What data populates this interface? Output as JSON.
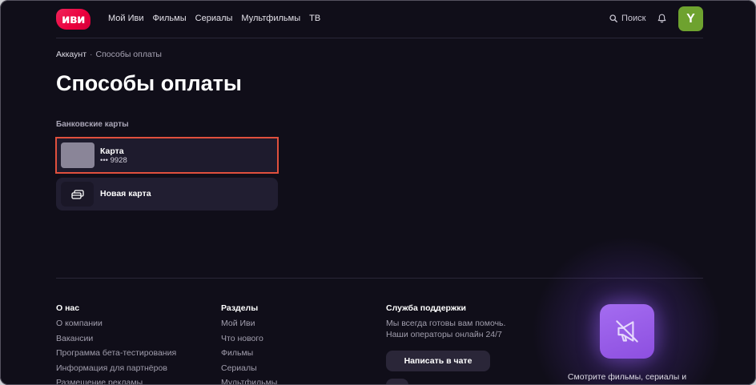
{
  "header": {
    "logo_text": "иви",
    "nav": [
      "Мой Иви",
      "Фильмы",
      "Сериалы",
      "Мультфильмы",
      "ТВ"
    ],
    "search_label": "Поиск",
    "avatar_letter": "Y"
  },
  "breadcrumb": {
    "parent": "Аккаунт",
    "separator": "·",
    "current": "Способы оплаты"
  },
  "page_title": "Способы оплаты",
  "bank_cards": {
    "section_label": "Банковские карты",
    "cards": [
      {
        "title": "Карта",
        "number": "••• 9928"
      }
    ],
    "new_card_label": "Новая карта"
  },
  "footer": {
    "about": {
      "title": "О нас",
      "links": [
        "О компании",
        "Вакансии",
        "Программа бета-тестирования",
        "Информация для партнёров",
        "Размещение рекламы"
      ]
    },
    "sections": {
      "title": "Разделы",
      "links": [
        "Мой Иви",
        "Что нового",
        "Фильмы",
        "Сериалы",
        "Мультфильмы"
      ]
    },
    "support": {
      "title": "Служба поддержки",
      "lines": [
        "Мы всегда готовы вам помочь.",
        "Наши операторы онлайн 24/7"
      ],
      "chat_button": "Написать в чате"
    },
    "promo": {
      "text": "Смотрите фильмы, сериалы и"
    }
  },
  "icons": {
    "search": "search-icon",
    "notifications": "bell-icon",
    "new_card": "credit-card-add-icon",
    "promo": "megaphone-off-icon"
  },
  "colors": {
    "background": "#100e19",
    "brand": "#ea003d",
    "avatar": "#6ea22f",
    "selection_outline": "#e0503d",
    "promo_icon": "#9a5ce8"
  }
}
